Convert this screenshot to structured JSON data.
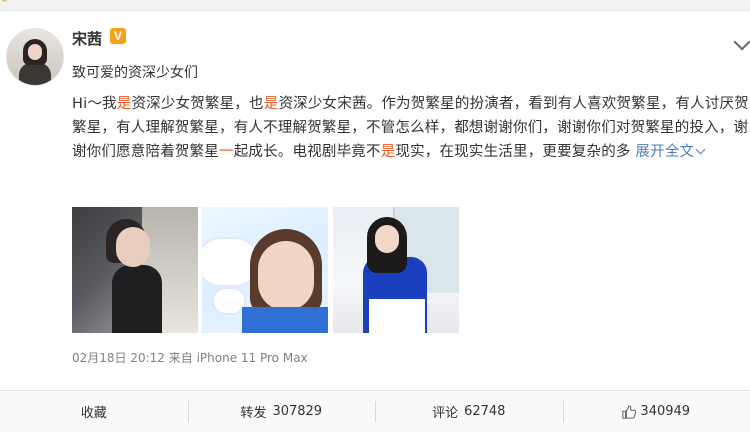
{
  "post": {
    "author": "宋茜",
    "verified_badge": "V",
    "subtitle": "致可爱的资深少女们",
    "content_parts": [
      "Hi～我",
      "是",
      "资深少女贺繁星，也",
      "是",
      "资深少女宋茜。作为贺繁星的扮演者，看到有人喜欢贺繁星，有人讨厌贺繁星，有人理解贺繁星，有人不理解贺繁星，不管怎么样，都想谢谢你们，谢谢你们对贺繁星的投入，谢谢你们愿意陪着贺繁星",
      "一",
      "起成长。电视剧毕竟不",
      "是",
      "现实，在现实生活里，更要复杂的多 "
    ],
    "expand_label": "展开全文",
    "meta_time": "02月18日 20:12",
    "meta_source": "来自 iPhone 11 Pro Max"
  },
  "actions": {
    "favorite_label": "收藏",
    "repost_label": "转发",
    "repost_count": "307829",
    "comment_label": "评论",
    "comment_count": "62748",
    "like_count": "340949"
  },
  "colors": {
    "highlight": "#eb5e28",
    "link": "#4a7fbe",
    "badge": "#f7a21b"
  },
  "icons": {
    "verified": "verified-v-badge-icon",
    "collapse": "chevron-down-icon",
    "like": "thumbs-up-icon"
  }
}
